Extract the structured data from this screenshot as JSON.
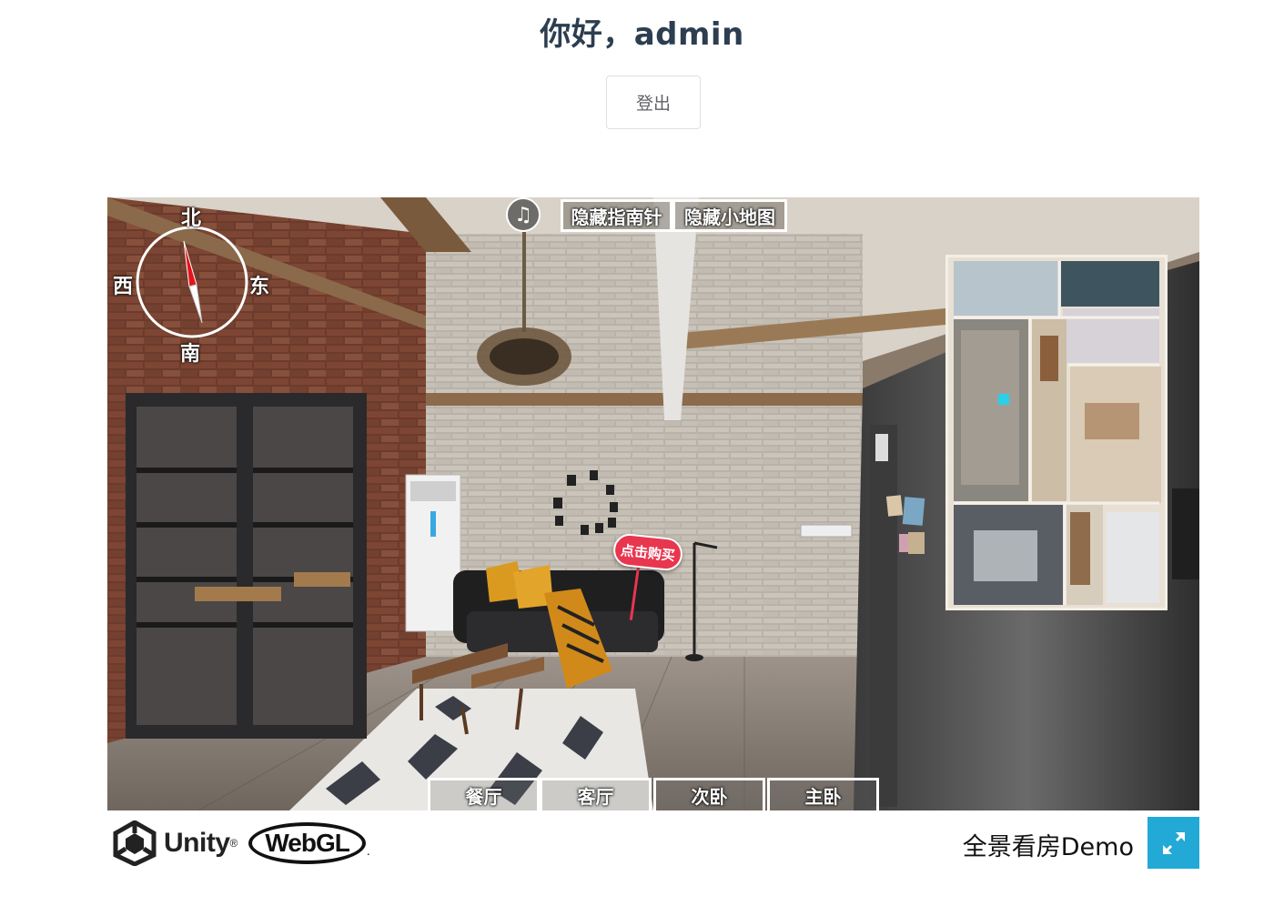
{
  "header": {
    "greeting": "你好，admin",
    "logout_label": "登出"
  },
  "viewer": {
    "music_icon_glyph": "♫",
    "hide_compass_label": "隐藏指南针",
    "hide_minimap_label": "隐藏小地图",
    "compass": {
      "north": "北",
      "south": "南",
      "east": "东",
      "west": "西"
    },
    "buy_tag_label": "点击购买",
    "rooms": [
      "餐厅",
      "客厅",
      "次卧",
      "主卧"
    ]
  },
  "footer": {
    "unity_text": "Unity",
    "unity_tm": "®",
    "webgl_text": "WebGL",
    "webgl_dot": ".",
    "demo_title": "全景看房Demo"
  },
  "colors": {
    "fullscreen_button": "#22a9d6",
    "buy_tag": "#e8364f",
    "greeting": "#2c3e50"
  }
}
